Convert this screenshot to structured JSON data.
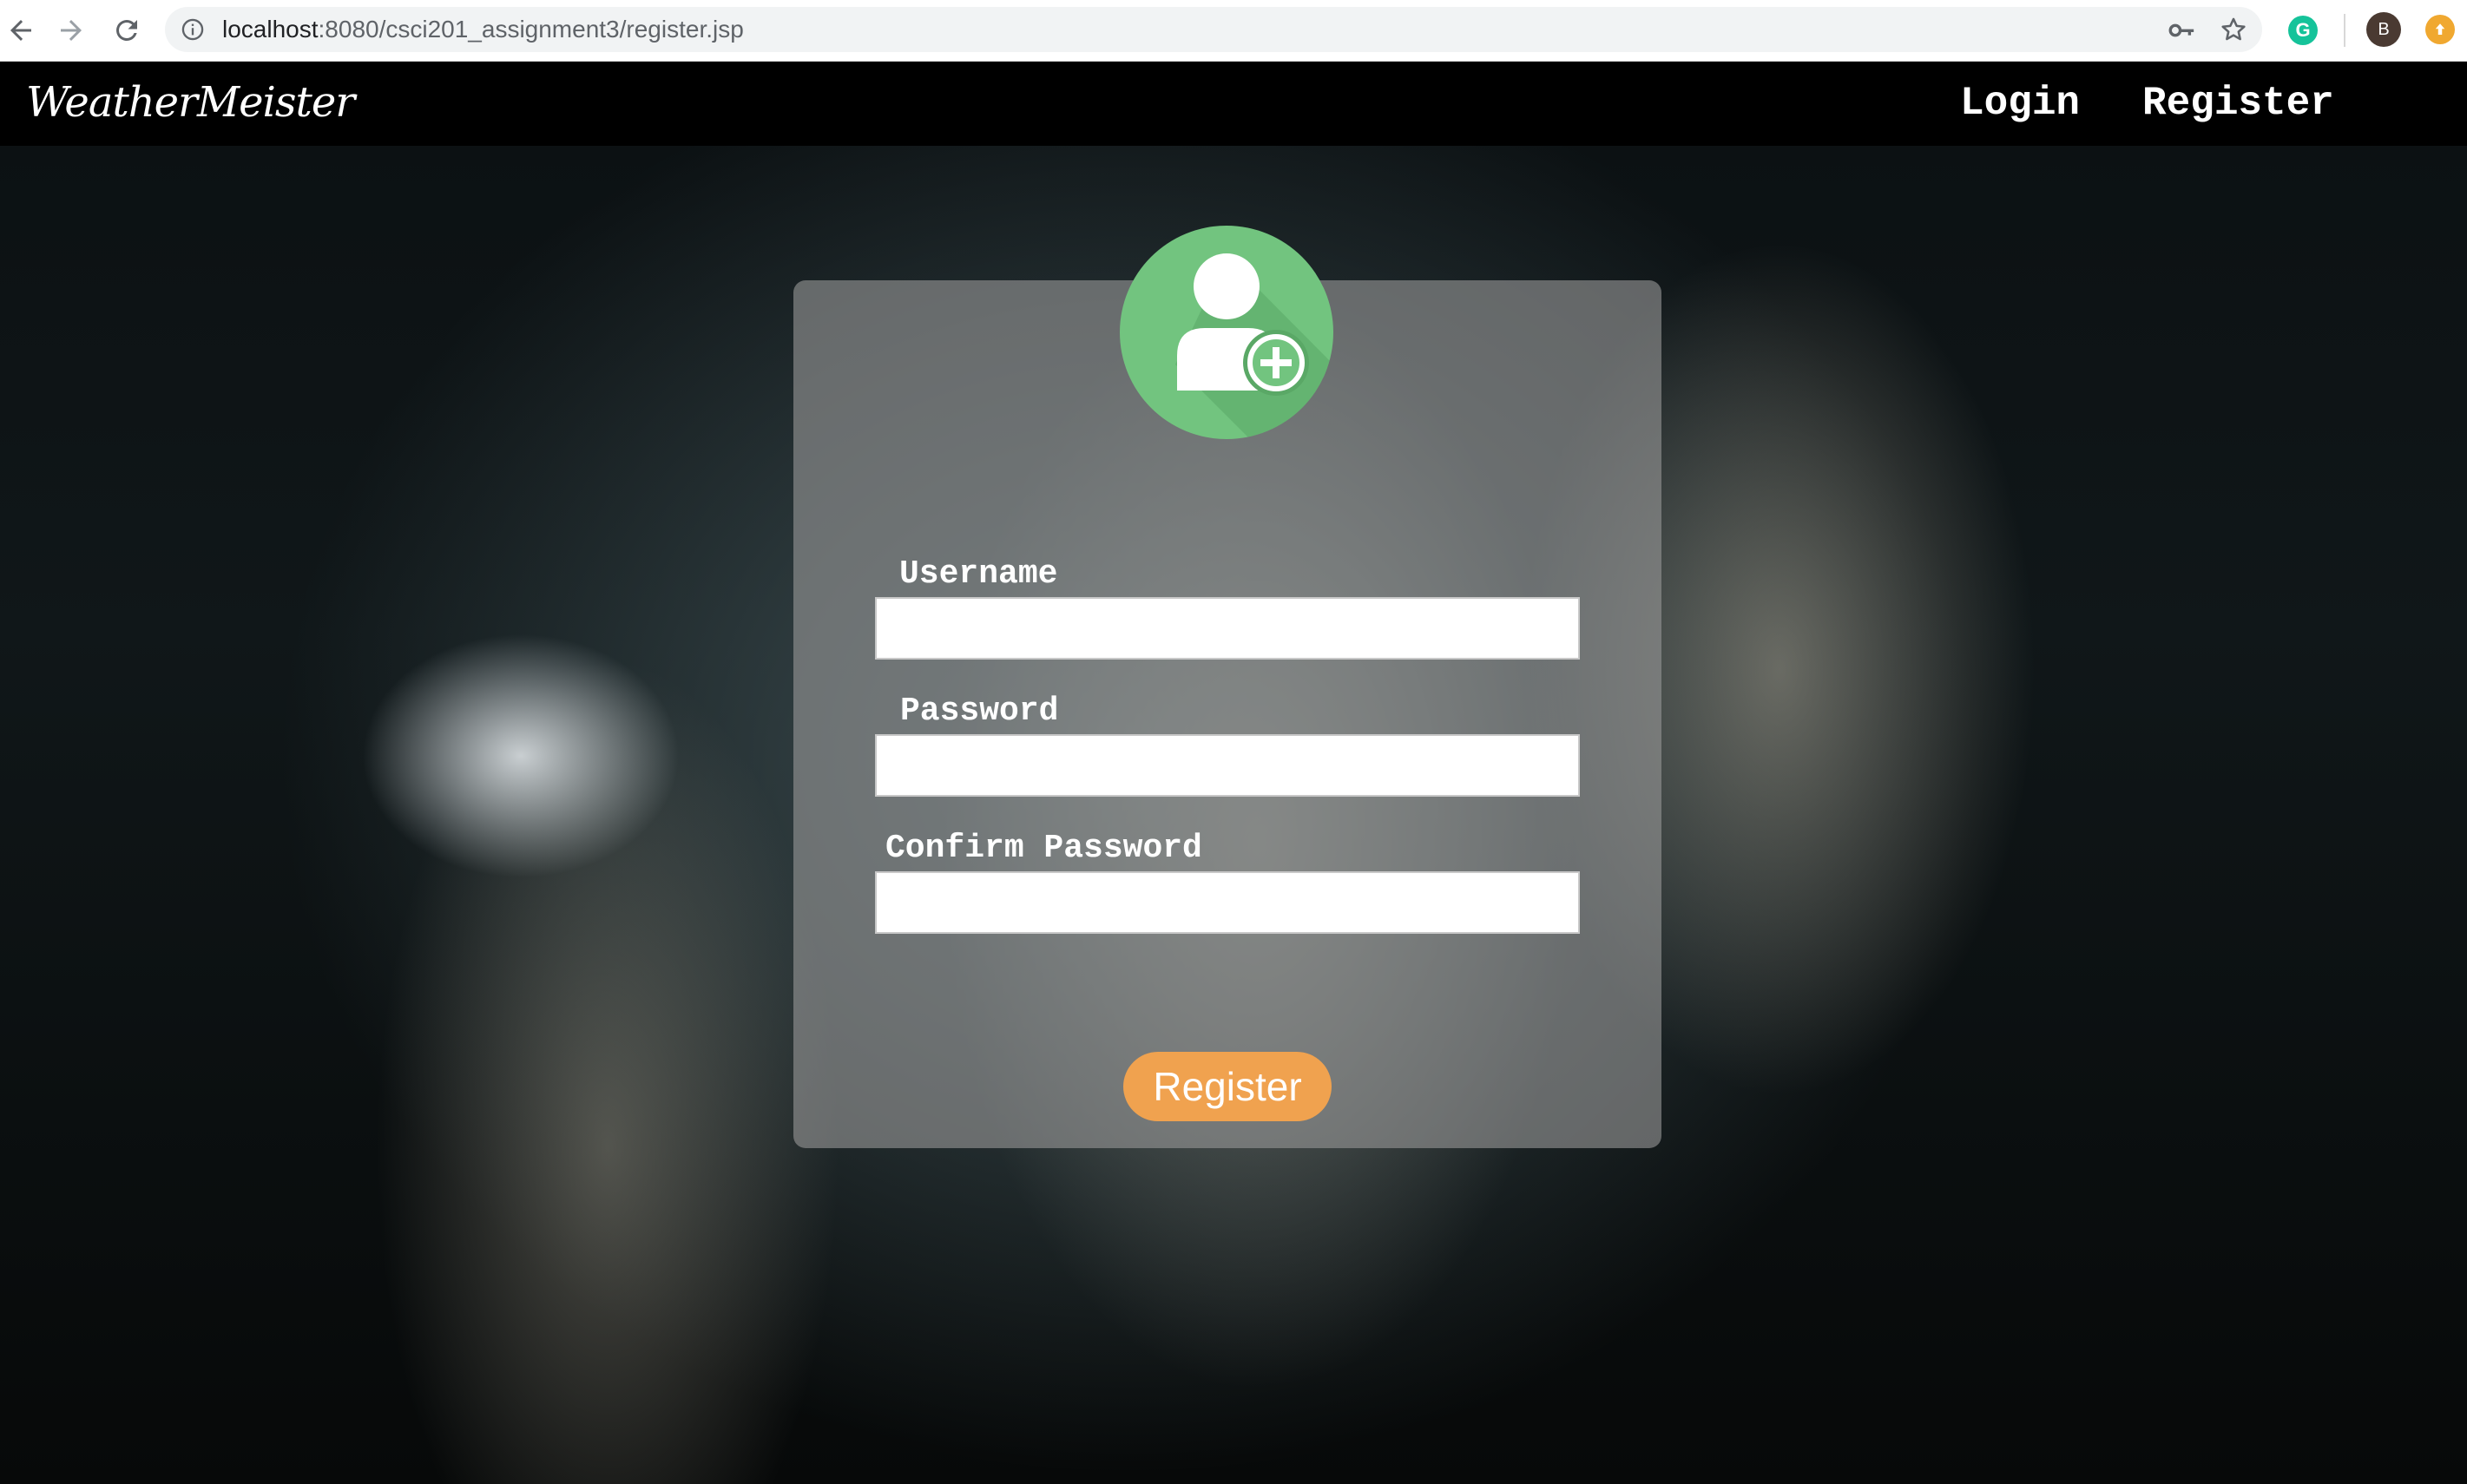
{
  "browser": {
    "url_host": "localhost",
    "url_rest": ":8080/csci201_assignment3/register.jsp",
    "profile_initial": "B",
    "icons": [
      "back-arrow-icon",
      "forward-arrow-icon",
      "reload-icon",
      "info-icon",
      "key-icon",
      "star-icon",
      "grammarly-icon",
      "extension-icon"
    ]
  },
  "site": {
    "brand": "WeatherMeister",
    "nav": {
      "login": "Login",
      "register": "Register"
    }
  },
  "form": {
    "username_label": "Username",
    "password_label": "Password",
    "confirm_password_label": "Confirm Password",
    "username_value": "",
    "password_value": "",
    "confirm_password_value": "",
    "submit_label": "Register"
  },
  "colors": {
    "accent_green": "#72c47f",
    "button_orange": "#f0a24f",
    "navbar": "#000000"
  }
}
